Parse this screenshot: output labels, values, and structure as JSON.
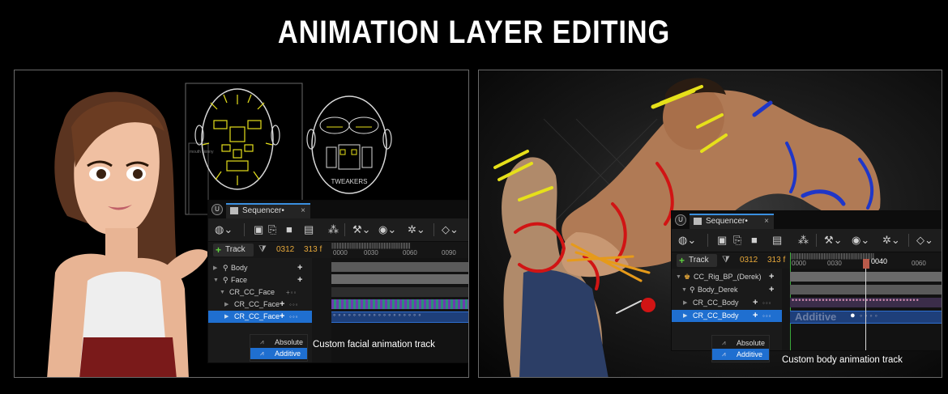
{
  "title": "ANIMATION LAYER EDITING",
  "left": {
    "sheet_labels": {
      "small": "mouth skinny",
      "tweakers": "TWEAKERS"
    },
    "sequencer": {
      "tab_label": "Sequencer•",
      "close": "×",
      "ue_logo": "U",
      "track_button": "Track",
      "frame_current": "0312",
      "frame_end": "313 f",
      "ruler_ticks": [
        "0000",
        "0030",
        "0060",
        "0090"
      ],
      "rows": [
        {
          "label": "Body"
        },
        {
          "label": "Face"
        },
        {
          "label": "CR_CC_Face"
        },
        {
          "label": "CR_CC_Face"
        },
        {
          "label": "CR_CC_Face"
        }
      ]
    },
    "blend_menu": {
      "options": [
        "Absolute",
        "Additive"
      ],
      "selected": "Additive"
    },
    "caption": "Custom facial animation track"
  },
  "right": {
    "sequencer": {
      "tab_label": "Sequencer•",
      "close": "×",
      "ue_logo": "U",
      "track_button": "Track",
      "frame_current": "0312",
      "frame_end": "313 f",
      "playhead_label": "0040",
      "ruler_ticks": [
        "0000",
        "0030",
        "0060"
      ],
      "rows": [
        {
          "label": "CC_Rig_BP_(Derek)"
        },
        {
          "label": "Body_Derek"
        },
        {
          "label": "CR_CC_Body"
        },
        {
          "label": "CR_CC_Body"
        }
      ],
      "watermark": "Additive"
    },
    "blend_menu": {
      "options": [
        "Absolute",
        "Additive"
      ],
      "selected": "Additive"
    },
    "caption": "Custom body animation track"
  },
  "colors": {
    "accent": "#1f6fd0",
    "frame": "#e8a93a",
    "add_green": "#5fcf3f",
    "rig_yellow": "#e6e01a",
    "rig_red": "#d11414",
    "rig_blue": "#1f36c8"
  },
  "icons": [
    "clapperboard-icon",
    "unreal-logo-icon",
    "plus-icon",
    "filter-icon",
    "camera-icon",
    "wrench-icon",
    "eye-icon",
    "gear-icon",
    "diamond-icon"
  ]
}
